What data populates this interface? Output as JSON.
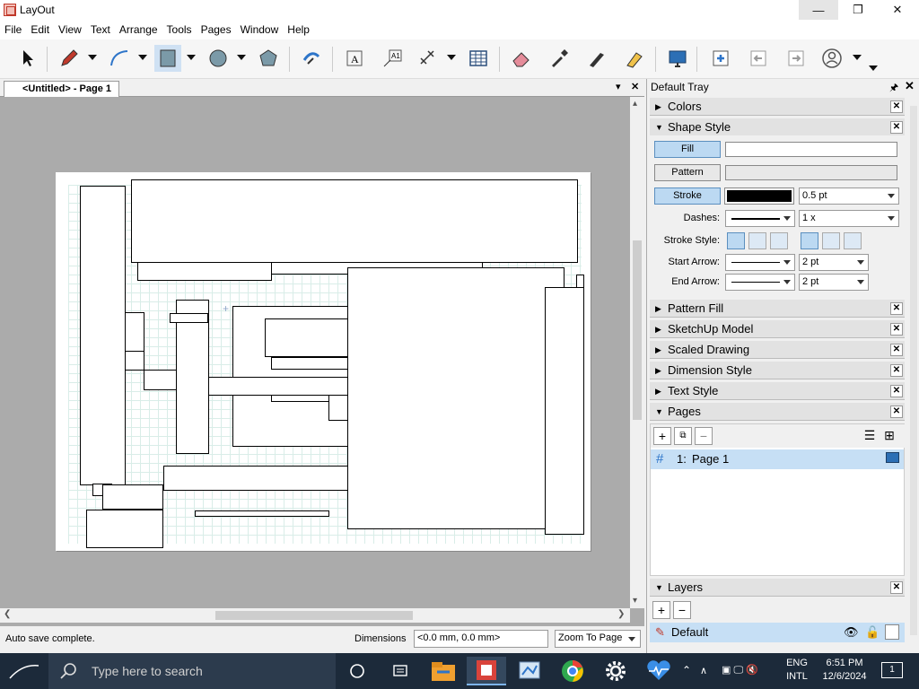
{
  "window": {
    "title": "LayOut"
  },
  "menu": [
    "File",
    "Edit",
    "View",
    "Text",
    "Arrange",
    "Tools",
    "Pages",
    "Window",
    "Help"
  ],
  "toolbar": {
    "icons": [
      "select-tool-icon",
      "pencil-icon",
      "arc-icon",
      "rectangle-icon",
      "circle-icon",
      "polygon-icon",
      "offset-icon",
      "text-icon",
      "label-icon",
      "dimension-icon",
      "table-icon",
      "eraser-icon",
      "eyedropper-icon",
      "split-icon",
      "join-icon",
      "presentation-icon",
      "add-page-icon",
      "previous-page-icon",
      "next-page-icon",
      "account-icon"
    ]
  },
  "document": {
    "tab_label": "<Untitled> - Page 1"
  },
  "status": {
    "message": "Auto save complete.",
    "dimensions_label": "Dimensions",
    "dimensions_value": "<0.0 mm, 0.0 mm>",
    "zoom": "Zoom To Page"
  },
  "tray": {
    "title": "Default Tray",
    "panels": {
      "colors": "Colors",
      "shape_style": "Shape Style",
      "pattern_fill": "Pattern Fill",
      "sketchup_model": "SketchUp Model",
      "scaled_drawing": "Scaled Drawing",
      "dimension_style": "Dimension Style",
      "text_style": "Text Style",
      "pages": "Pages",
      "layers": "Layers"
    },
    "shape_style": {
      "fill": "Fill",
      "pattern": "Pattern",
      "stroke": "Stroke",
      "stroke_weight": "0.5 pt",
      "dashes_label": "Dashes:",
      "dash_scale": "1 x",
      "stroke_style_label": "Stroke Style:",
      "start_arrow_label": "Start Arrow:",
      "start_arrow_size": "2 pt",
      "end_arrow_label": "End Arrow:",
      "end_arrow_size": "2 pt",
      "fill_color": "#ffffff",
      "stroke_color": "#000000"
    },
    "pages": {
      "items": [
        {
          "number": "1:",
          "name": "Page 1"
        }
      ]
    },
    "layers": {
      "items": [
        {
          "name": "Default"
        }
      ]
    }
  },
  "taskbar": {
    "search_placeholder": "Type here to search",
    "lang_top": "ENG",
    "lang_bottom": "INTL",
    "time": "6:51 PM",
    "date": "12/6/2024",
    "notification_count": "1"
  }
}
